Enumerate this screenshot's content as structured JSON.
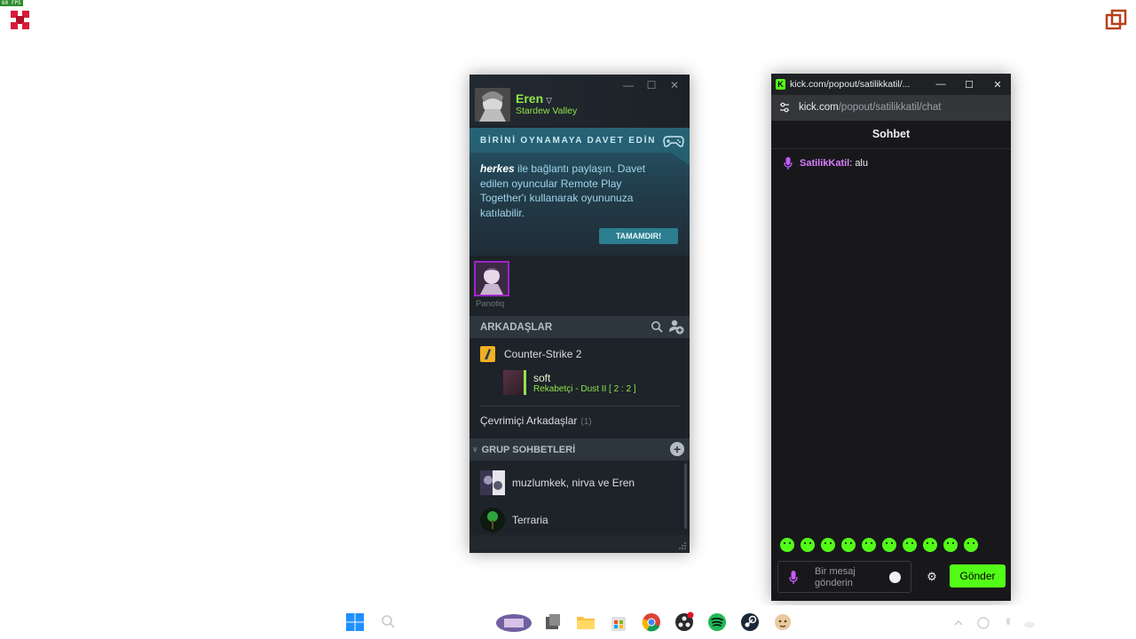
{
  "overlay": {
    "fps": "60 FPS"
  },
  "steam": {
    "user_name": "Eren",
    "user_game": "Stardew Valley",
    "invite": {
      "title": "BİRİNİ OYNAMAYA DAVET EDİN",
      "highlight": "herkes",
      "body": " ile bağlantı paylaşın. Davet edilen oyuncular Remote Play Together'ı kullanarak oyununuza katılabilir.",
      "button": "TAMAMDIR!"
    },
    "party_member": "Panotiq",
    "friends_header": "ARKADAŞLAR",
    "game_group": "Counter-Strike 2",
    "friend": {
      "name": "soft",
      "status": "Rekabetçi - Dust II [ 2 : 2 ]"
    },
    "online_label": "Çevrimiçi Arkadaşlar",
    "online_count": "(1)",
    "groups_header": "GRUP SOHBETLERİ",
    "groups": [
      {
        "name": "muzlumkek, nirva ve Eren"
      },
      {
        "name": "Terraria"
      }
    ]
  },
  "kick": {
    "tab_title": "kick.com/popout/satilikkatil/...",
    "url_host": "kick.com",
    "url_path": "/popout/satilikkatil/chat",
    "chat_title": "Sohbet",
    "message": {
      "user": "SatilikKatil",
      "separator": ":",
      "text": "alu"
    },
    "input_placeholder": "Bir mesaj gönderin",
    "send_button": "Gönder",
    "accent": "#53fc18"
  },
  "taskbar": {
    "items": [
      "windows-start-icon",
      "search-icon",
      "widget-icon",
      "file-explorer-icon",
      "folder-icon",
      "store-icon",
      "chrome-icon",
      "obs-icon",
      "spotify-icon",
      "steam-icon",
      "app-icon"
    ]
  }
}
